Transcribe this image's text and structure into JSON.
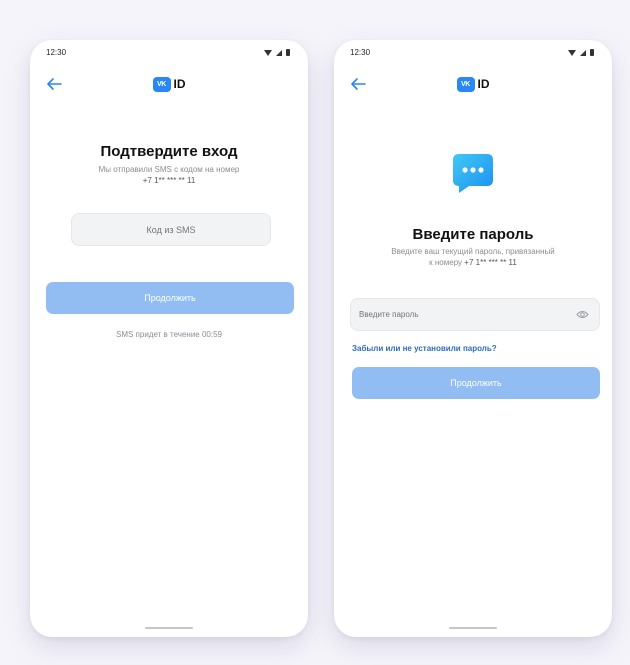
{
  "left_screen": {
    "status_time": "12:30",
    "logo_badge": "VK",
    "logo_text": "ID",
    "title": "Подтвердите вход",
    "subtitle": "Мы отправили SMS с кодом на номер",
    "phone": "+7 1** *** ** 11",
    "code_placeholder": "Код из SMS",
    "continue_label": "Продолжить",
    "timer_text": "SMS придет в течение 00:59"
  },
  "right_screen": {
    "status_time": "12:30",
    "logo_badge": "VK",
    "logo_text": "ID",
    "title": "Введите пароль",
    "subtitle": "Введите ваш текущий пароль, привязанный",
    "subtitle_prefix": "к номеру ",
    "phone": "+7 1** *** ** 11",
    "password_placeholder": "Введите пароль",
    "forgot_link": "Забыли или не установили пароль?",
    "continue_label": "Продолжить"
  },
  "icons": {
    "back": "arrow-left-icon",
    "visibility": "eye-icon",
    "app": "chat-bubble-icon"
  },
  "colors": {
    "accent": "#2787f5",
    "button_disabled": "#91bdf3",
    "link": "#2d6cc0",
    "background": "#f5f4fa"
  }
}
